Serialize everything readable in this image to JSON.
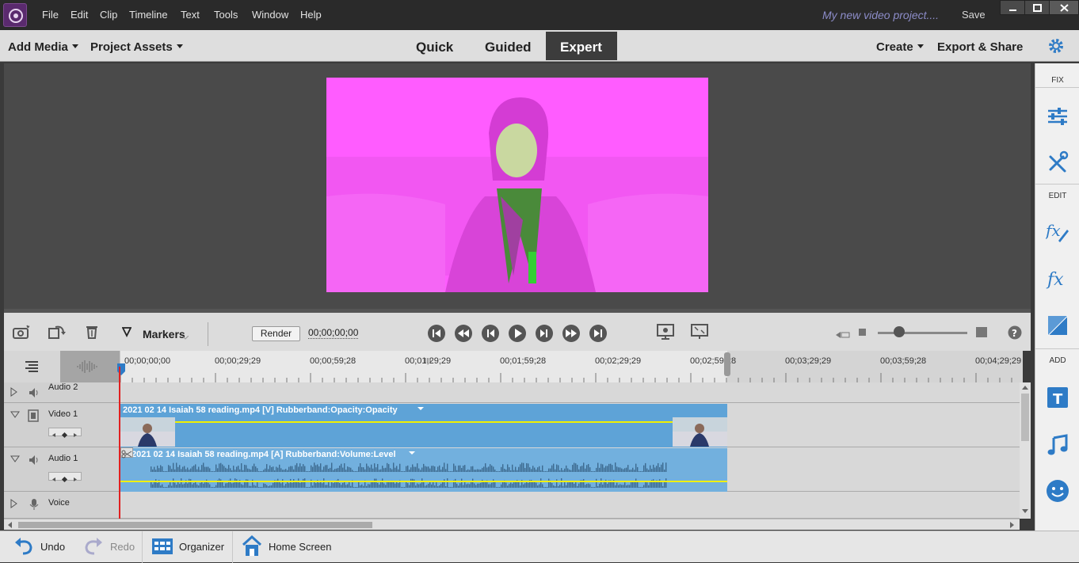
{
  "menubar": {
    "items": [
      "File",
      "Edit",
      "Clip",
      "Timeline",
      "Text",
      "Tools",
      "Window",
      "Help"
    ],
    "project_title": "My new video project....",
    "save_label": "Save"
  },
  "toolbar": {
    "add_media": "Add Media",
    "project_assets": "Project Assets",
    "modes": [
      "Quick",
      "Guided",
      "Expert"
    ],
    "active_mode": "Expert",
    "create": "Create",
    "export_share": "Export & Share"
  },
  "right_panel": {
    "fix_label": "FIX",
    "edit_label": "EDIT",
    "add_label": "ADD",
    "icons": [
      "adjustments-icon",
      "tools-icon",
      "applied-effects-icon",
      "effects-icon",
      "transitions-icon",
      "titles-icon",
      "music-icon",
      "graphics-icon"
    ]
  },
  "timeline_bar": {
    "markers_label": "Markers",
    "render_label": "Render",
    "timecode": "00;00;00;00"
  },
  "ruler": {
    "labels": [
      "00;00;00;00",
      "00;00;29;29",
      "00;00;59;28",
      "00;01;29;29",
      "00;01;59;28",
      "00;02;29;29",
      "00;02;59;28",
      "00;03;29;29",
      "00;03;59;28",
      "00;04;29;29"
    ]
  },
  "tracks": [
    {
      "name": "Audio 2",
      "type": "audio"
    },
    {
      "name": "Video 1",
      "type": "video",
      "clip_title": "2021 02 14 Isaiah 58 reading.mp4 [V] Rubberband:Opacity:Opacity"
    },
    {
      "name": "Audio 1",
      "type": "audio",
      "clip_title": "2021 02 14 Isaiah 58 reading.mp4 [A] Rubberband:Volume:Level"
    },
    {
      "name": "Voice",
      "type": "voice"
    }
  ],
  "bottom_bar": {
    "undo": "Undo",
    "redo": "Redo",
    "organizer": "Organizer",
    "home_screen": "Home Screen"
  },
  "colors": {
    "accent_dark": "#3c3c3c",
    "clip_blue": "#5ea3d7",
    "rubberband": "#f0f000",
    "playhead": "#e02020",
    "icon_blue": "#2e7bc6"
  }
}
